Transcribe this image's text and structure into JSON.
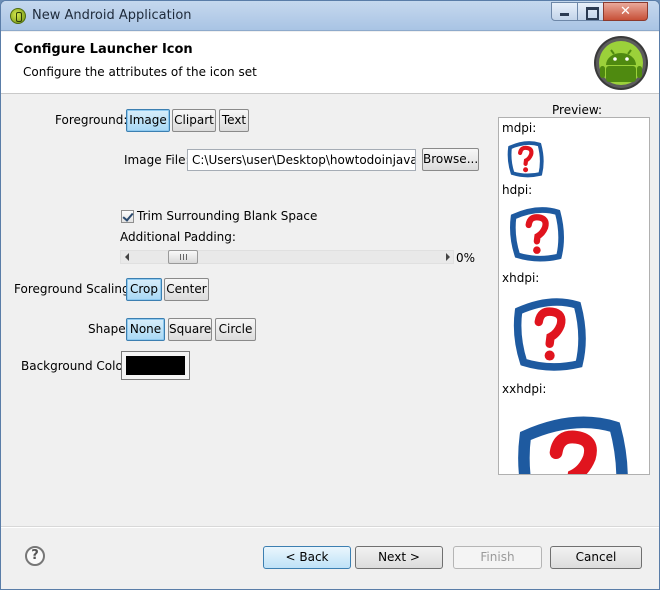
{
  "window": {
    "title": "New Android Application"
  },
  "header": {
    "title": "Configure Launcher Icon",
    "subtitle": "Configure the attributes of the icon set"
  },
  "foreground": {
    "label": "Foreground:",
    "options": [
      "Image",
      "Clipart",
      "Text"
    ],
    "selected": "Image"
  },
  "image_file": {
    "label": "Image File:",
    "value": "C:\\Users\\user\\Desktop\\howtodoinjava_logo",
    "browse": "Browse..."
  },
  "trim": {
    "label": "Trim Surrounding Blank Space",
    "checked": true
  },
  "padding": {
    "label": "Additional Padding:",
    "value": "0%"
  },
  "scaling": {
    "label": "Foreground Scaling:",
    "options": [
      "Crop",
      "Center"
    ],
    "selected": "Crop"
  },
  "shape": {
    "label": "Shape",
    "options": [
      "None",
      "Square",
      "Circle"
    ],
    "selected": "None"
  },
  "background": {
    "label": "Background Color:",
    "color": "#000000"
  },
  "preview": {
    "label": "Preview:",
    "densities": [
      "mdpi:",
      "hdpi:",
      "xhdpi:",
      "xxhdpi:"
    ]
  },
  "footer": {
    "help": "?",
    "back": "< Back",
    "next": "Next >",
    "finish": "Finish",
    "cancel": "Cancel"
  },
  "colors": {
    "icon_blue": "#1e5aa0",
    "icon_red": "#e0141e",
    "selected_bg": "#a8d8f5"
  }
}
